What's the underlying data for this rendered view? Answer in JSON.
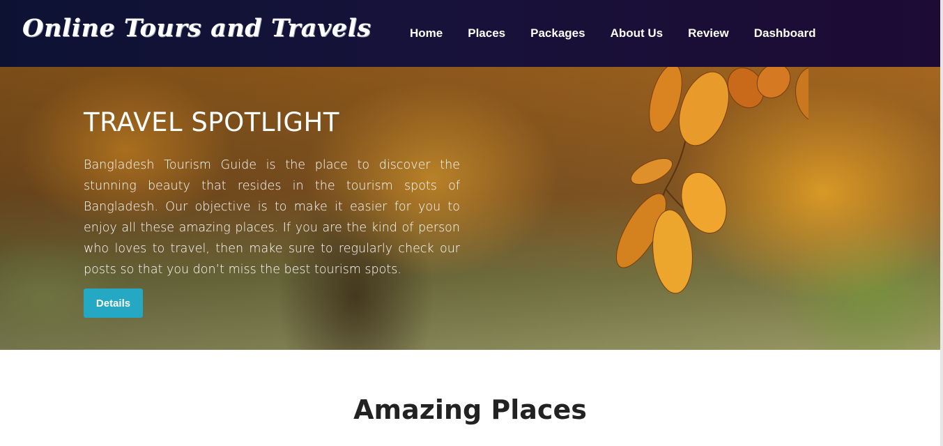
{
  "brand": {
    "name": "Online Tours and Travels"
  },
  "nav": {
    "items": [
      {
        "label": "Home"
      },
      {
        "label": "Places"
      },
      {
        "label": "Packages"
      },
      {
        "label": "About Us"
      },
      {
        "label": "Review"
      },
      {
        "label": "Dashboard"
      }
    ]
  },
  "hero": {
    "title": "TRAVEL SPOTLIGHT",
    "description": "Bangladesh Tourism Guide is the place to discover the stunning beauty that resides in the tourism spots of Bangladesh. Our objective is to make it easier for you to enjoy all these amazing places. If you are the kind of person who loves to travel, then make sure to regularly check our posts so that you don’t miss the best tourism spots.",
    "button_label": "Details",
    "background_image": "autumn-leaves-photo"
  },
  "section": {
    "title": "Amazing Places"
  },
  "colors": {
    "navbar": "#17123a",
    "button": "#25a8c3",
    "text_dark": "#222222"
  }
}
